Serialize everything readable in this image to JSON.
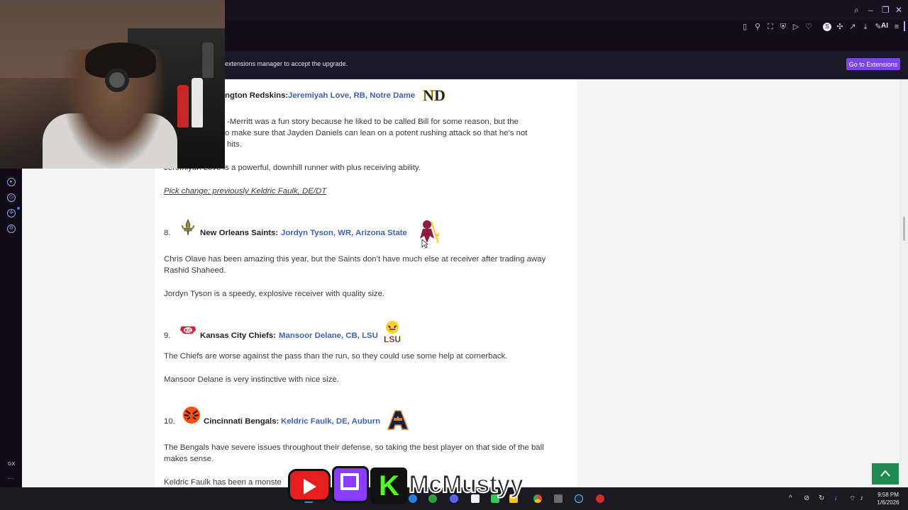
{
  "window": {
    "minimize": "–",
    "restore": "❐",
    "close": "✕"
  },
  "toolbar": {
    "ai_label": "AI"
  },
  "notification": {
    "text": "extensions manager to accept the upgrade.",
    "button": "Go to Extensions"
  },
  "sidebar": {
    "badge": "GX",
    "more": "···"
  },
  "article": {
    "pick7": {
      "team": "ngton Redskins:",
      "player": "Jeremiyah Love, RB, Notre Dame",
      "para1_line1": "-Merritt was a fun story because he liked to be called Bill for some reason, but the",
      "para1_line2": "o make sure that Jayden Daniels can lean on a potent rushing attack so that he's not",
      "para1_line3": "hits.",
      "para2": "Jeremiyah Love is a powerful, downhill runner with plus receiving ability.",
      "note": "Pick change; previously Keldric Faulk, DE/DT"
    },
    "pick8": {
      "number": "8.",
      "team": "New Orleans Saints:",
      "player": "Jordyn Tyson, WR, Arizona State",
      "para1_line1": "Chris Olave has been amazing this year, but the Saints don’t have much else at receiver after trading away",
      "para1_line2": "Rashid Shaheed.",
      "para2": "Jordyn Tyson is a speedy, explosive receiver with quality size."
    },
    "pick9": {
      "number": "9.",
      "team": "Kansas City Chiefs:",
      "player": "Mansoor Delane, CB, LSU",
      "school_logo_text": "LSU",
      "para1": "The Chiefs are worse against the pass than the run, so they could use some help at cornerback.",
      "para2": "Mansoor Delane is very instinctive with nice size."
    },
    "pick10": {
      "number": "10.",
      "team": "Cincinnati Bengals:",
      "player": "Keldric Faulk, DE, Auburn",
      "para1_line1": "The Bengals have severe issues throughout their defense, so taking the best player on that side of the ball",
      "para1_line2": "makes sense.",
      "para2": "Keldric Faulk has been a monste"
    }
  },
  "overlay": {
    "kick_letter": "K",
    "username": "McMustyy"
  },
  "taskbar": {
    "time": "9:58 PM",
    "date": "1/6/2026"
  },
  "colors": {
    "link": "#3f63b5",
    "accent": "#7b45ea",
    "scroll_top": "#1e8a52"
  }
}
